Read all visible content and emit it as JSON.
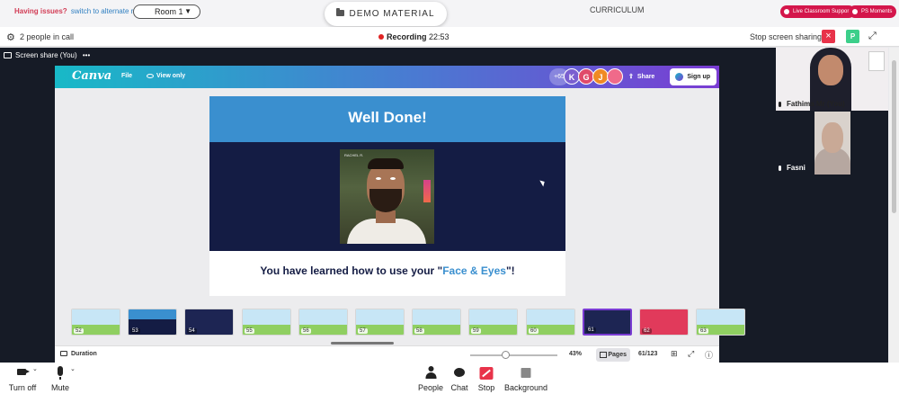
{
  "topbar": {
    "issues_text": "Having issues?",
    "alt_room_link": "switch to alternate room",
    "room_select": "Room 1",
    "demo_material": "DEMO MATERIAL",
    "curriculum": "CURRICULUM",
    "live_support": "Live Classroom Support",
    "ps_moments": "PS Moments"
  },
  "callbar": {
    "people_count": "2 people in call",
    "recording_label": "Recording",
    "recording_time": "22:53",
    "stop_sharing": "Stop screen sharing",
    "p_badge": "P"
  },
  "share": {
    "label": "Screen share (You)",
    "more": "•••"
  },
  "canva": {
    "logo": "Canva",
    "file": "File",
    "view_only": "View only",
    "extra_count": "+65",
    "avatars": [
      {
        "letter": "K",
        "color": "#7a5fd0"
      },
      {
        "letter": "G",
        "color": "#e04a6a"
      },
      {
        "letter": "J",
        "color": "#f08a24"
      },
      {
        "letter": "",
        "color": "#f06a8a"
      }
    ],
    "share": "Share",
    "sign_up": "Sign up"
  },
  "slide": {
    "title": "Well Done!",
    "watermark": "RACHEL R.",
    "text_before": "You have learned how to use your \"",
    "text_highlight": "Face & Eyes",
    "text_after": "\"!"
  },
  "thumbnails": [
    {
      "num": "52",
      "style": "green"
    },
    {
      "num": "53",
      "style": "blue"
    },
    {
      "num": "54",
      "style": "dark"
    },
    {
      "num": "55",
      "style": "green"
    },
    {
      "num": "56",
      "style": "green"
    },
    {
      "num": "57",
      "style": "green"
    },
    {
      "num": "58",
      "style": "green"
    },
    {
      "num": "59",
      "style": "green"
    },
    {
      "num": "60",
      "style": "green"
    },
    {
      "num": "61",
      "style": "dark",
      "selected": true
    },
    {
      "num": "62",
      "style": "red"
    },
    {
      "num": "63",
      "style": "green"
    }
  ],
  "footer": {
    "duration": "Duration",
    "zoom_percent": "43%",
    "pages": "Pages",
    "page_count": "61/123",
    "zoom_value": 0.43
  },
  "videos": {
    "self_name": "Fathima Mr (You)",
    "other_name": "Fasni"
  },
  "controls": {
    "turn_off": "Turn off",
    "mute": "Mute",
    "people": "People",
    "chat": "Chat",
    "stop": "Stop",
    "background": "Background"
  }
}
